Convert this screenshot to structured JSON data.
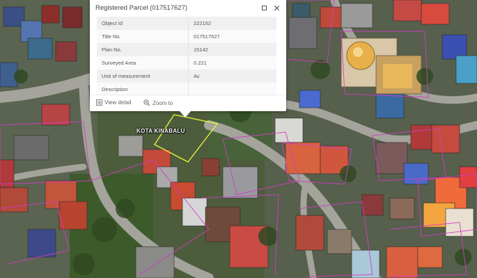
{
  "popup": {
    "title": "Registered Parcel (017517627)",
    "attributes": [
      {
        "key": "Object Id",
        "value": "222152"
      },
      {
        "key": "Title No.",
        "value": "017517627"
      },
      {
        "key": "Plan No.",
        "value": "15142"
      },
      {
        "key": "Surveyed Area",
        "value": "0.221"
      },
      {
        "key": "Unit of measurement",
        "value": "Ac"
      },
      {
        "key": "Description",
        "value": ""
      }
    ],
    "actions": {
      "view_detail": "View detail",
      "zoom_to": "Zoom to"
    }
  },
  "map": {
    "place_label": "KOTA KINABALU",
    "colors": {
      "selected_parcel": "#e6f23a",
      "parcel_lines": "#d23cc4",
      "vegetation": "#3f5a2a",
      "road": "#9a9a94"
    }
  }
}
